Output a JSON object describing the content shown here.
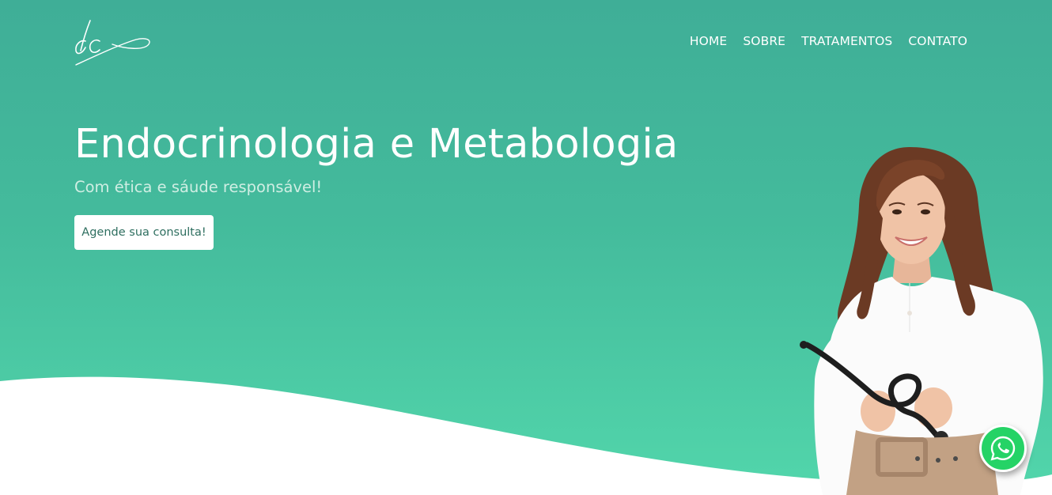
{
  "brand": {
    "logo_text": "dc",
    "logo_icon": "signature-logo"
  },
  "nav": {
    "items": [
      {
        "label": "HOME"
      },
      {
        "label": "SOBRE"
      },
      {
        "label": "TRATAMENTOS"
      },
      {
        "label": "CONTATO"
      }
    ]
  },
  "hero": {
    "title": "Endocrinologia e Metabologia",
    "subtitle": "Com ética e sáude responsável!",
    "cta_label": "Agende sua consulta!"
  },
  "floating": {
    "whatsapp_icon": "whatsapp-icon"
  },
  "colors": {
    "gradient_top": "#3fae97",
    "gradient_bottom": "#52d6ab",
    "accent_text": "#2f6f60",
    "whatsapp": "#25d366"
  }
}
